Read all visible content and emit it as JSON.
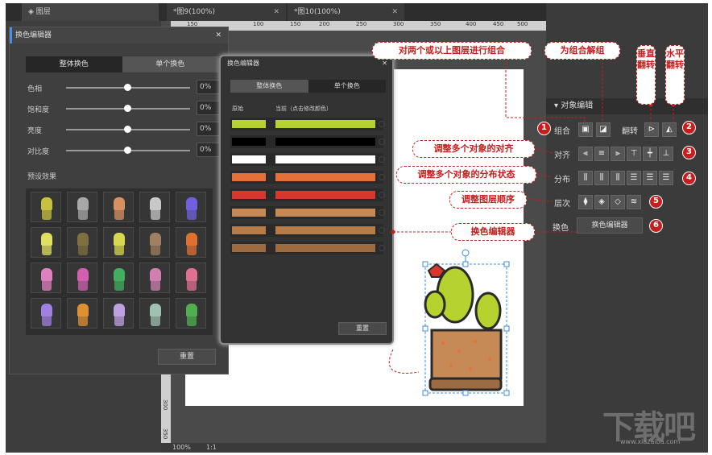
{
  "tabs": [
    {
      "label": "图层"
    },
    {
      "label": "*图9(100%)"
    },
    {
      "label": "*图10(100%)"
    }
  ],
  "ruler": {
    "h_ticks": [
      "150",
      "100",
      "150",
      "200",
      "250",
      "300",
      "350",
      "400",
      "450",
      "500"
    ],
    "v_ticks": [
      "300",
      "350"
    ]
  },
  "status": {
    "zoom": "100%",
    "ratio": "1:1"
  },
  "dialog1": {
    "title": "换色编辑器",
    "tab_all": "整体换色",
    "tab_single": "单个换色",
    "sliders": [
      {
        "label": "色相",
        "value": "0%"
      },
      {
        "label": "饱和度",
        "value": "0%"
      },
      {
        "label": "亮度",
        "value": "0%"
      },
      {
        "label": "对比度",
        "value": "0%"
      }
    ],
    "presets_label": "预设效果",
    "reset": "重置",
    "presets": [
      [
        "#c8c040",
        "#a8a8a8",
        "#d89060",
        "#c8c8c8",
        "#7060e0"
      ],
      [
        "#e0e060",
        "#807040",
        "#d8d850",
        "#a08060",
        "#e07030"
      ],
      [
        "#e080c0",
        "#d060b0",
        "#40b060",
        "#d080b0",
        "#e07090"
      ],
      [
        "#a080e0",
        "#e09030",
        "#c0a0e0",
        "#a0c0b0",
        "#50b050"
      ]
    ]
  },
  "dialog2": {
    "title": "换色编辑器",
    "tab_all": "整体换色",
    "tab_single": "单个换色",
    "col_orig": "原始",
    "col_current": "当前（点击修改颜色）",
    "reset": "重置",
    "colors": [
      "#b5d22e",
      "#000000",
      "#ffffff",
      "#e6703a",
      "#d8362f",
      "#c58a56",
      "#b87c48",
      "#9c6b42"
    ]
  },
  "panel": {
    "section": "对象编辑",
    "group": "组合",
    "flip": "翻转",
    "align": "对齐",
    "distribute": "分布",
    "order": "层次",
    "recolor": "换色",
    "recolor_btn": "换色编辑器"
  },
  "callouts": {
    "group": "对两个或以上图层进行组合",
    "ungroup": "为组合解组",
    "vflip": "垂直翻转",
    "hflip": "水平翻转",
    "align": "调整多个对象的对齐",
    "distribute": "调整多个对象的分布状态",
    "order": "调整图层顺序",
    "recolor": "换色编辑器"
  },
  "numbers": [
    "1",
    "2",
    "3",
    "4",
    "5",
    "6"
  ],
  "watermark": {
    "big": "下载吧",
    "small": "www.xiazaiba.com"
  }
}
